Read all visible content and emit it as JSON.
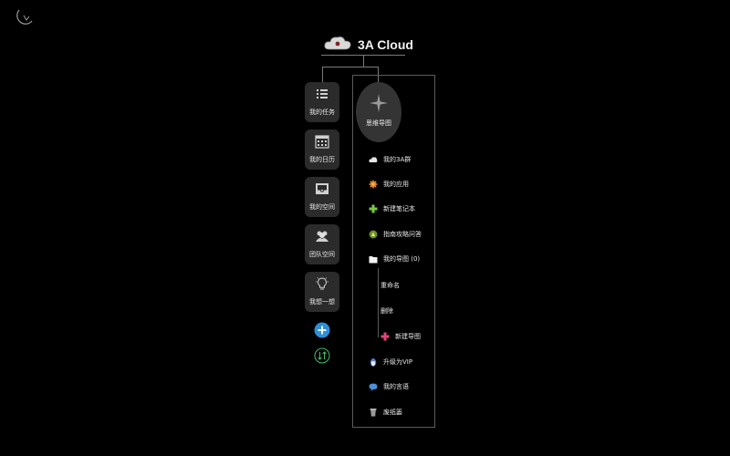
{
  "app": {
    "title": "3A Cloud"
  },
  "sidebar": {
    "items": [
      {
        "label": "我的任务",
        "icon": "list-icon"
      },
      {
        "label": "我的日历",
        "icon": "calendar-icon"
      },
      {
        "label": "我的空间",
        "icon": "inbox-icon"
      },
      {
        "label": "团队空间",
        "icon": "team-icon"
      },
      {
        "label": "我想一想",
        "icon": "lightbulb-icon"
      }
    ],
    "add_icon": "plus-circle-icon",
    "sort_icon": "sort-icon"
  },
  "panel": {
    "mindmap_label": "思维导图",
    "menu": [
      {
        "label": "我的3A群",
        "icon": "cloud-icon"
      },
      {
        "label": "我的应用",
        "icon": "gear-icon"
      },
      {
        "label": "新建笔记本",
        "icon": "plus-icon"
      },
      {
        "label": "指南攻略问答",
        "icon": "guide-icon"
      },
      {
        "label": "我的导图 (0)",
        "icon": "folder-icon"
      },
      {
        "label": "重命名",
        "icon": ""
      },
      {
        "label": "删除",
        "icon": ""
      },
      {
        "label": "新建导图",
        "icon": "plus-icon"
      },
      {
        "label": "升级为VIP",
        "icon": "penguin-icon"
      },
      {
        "label": "我的言语",
        "icon": "speech-bubble-icon"
      },
      {
        "label": "废纸篓",
        "icon": "trash-icon"
      }
    ]
  },
  "colors": {
    "background": "#000000",
    "button_bg": "#2b2b2b",
    "accent_blue": "#2e8fd8",
    "accent_green": "#3fbf6a",
    "accent_pink": "#e0457b"
  }
}
